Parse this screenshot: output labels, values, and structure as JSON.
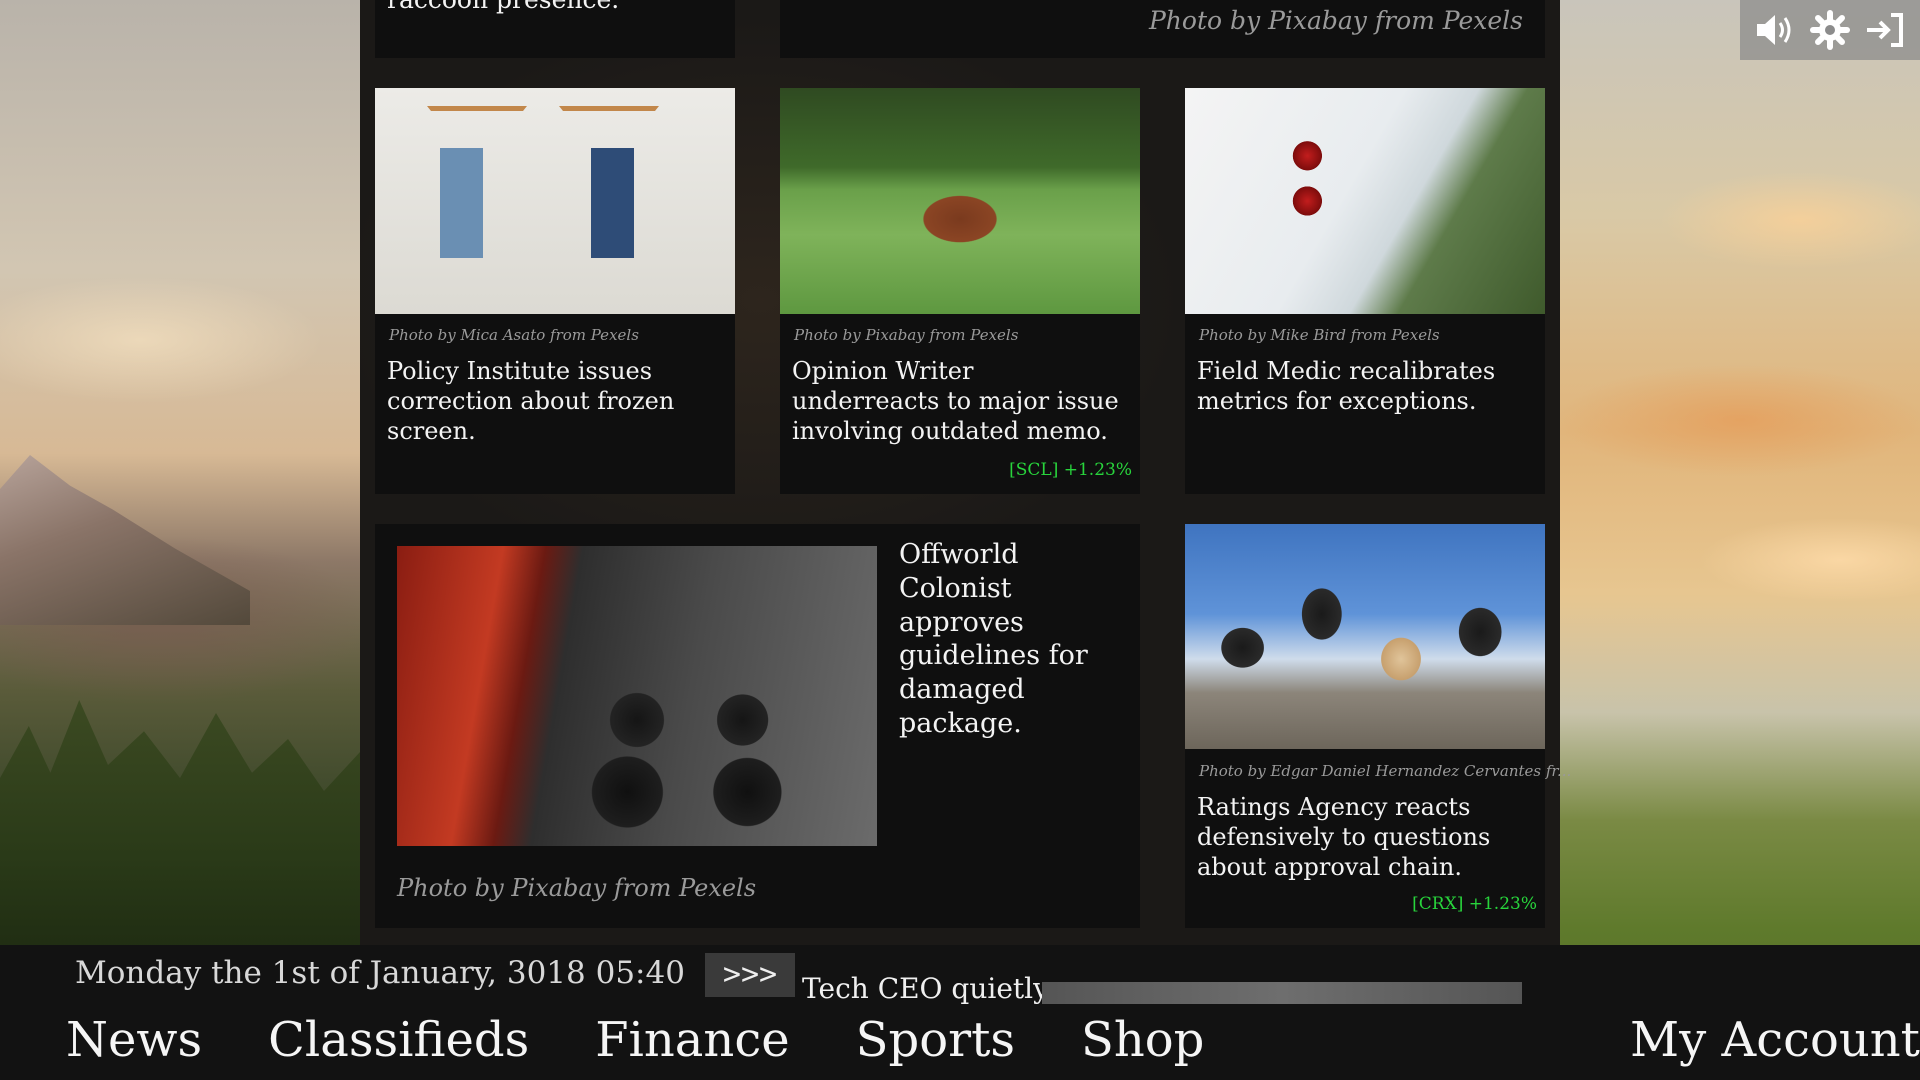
{
  "top_partial": {
    "left_text": "raccoon presence.",
    "right_credit": "Photo by Pixabay from Pexels"
  },
  "cards": [
    {
      "credit": "Photo by Mica Asato from Pexels",
      "headline": "Policy Institute issues correction about frozen screen.",
      "ticker": ""
    },
    {
      "credit": "Photo by Pixabay from Pexels",
      "headline": "Opinion Writer underreacts to major issue involving outdated memo.",
      "ticker": "[SCL] +1.23%"
    },
    {
      "credit": "Photo by Mike Bird from Pexels",
      "headline": "Field Medic recalibrates metrics for exceptions.",
      "ticker": ""
    },
    {
      "credit": "Photo by Pixabay from Pexels",
      "headline": "Offworld Colonist approves guidelines for damaged package.",
      "ticker": ""
    },
    {
      "credit": "Photo by Edgar Daniel Hernandez Cervantes fr...",
      "headline": "Ratings Agency reacts defensively to questions about approval chain.",
      "ticker": "[CRX] +1.23%"
    }
  ],
  "bottom": {
    "date": "Monday the 1st of January, 3018 05:40",
    "ticker_button": ">>>",
    "ticker_text": "Tech CEO quietly"
  },
  "nav": {
    "items": [
      "News",
      "Classifieds",
      "Finance",
      "Sports",
      "Shop"
    ],
    "account": "My Account"
  },
  "controls": {
    "icons": [
      "volume-icon",
      "settings-icon",
      "logout-icon"
    ]
  },
  "colors": {
    "ticker_green": "#28d43c",
    "panel": "#0f0f0f",
    "bar": "#121212"
  }
}
